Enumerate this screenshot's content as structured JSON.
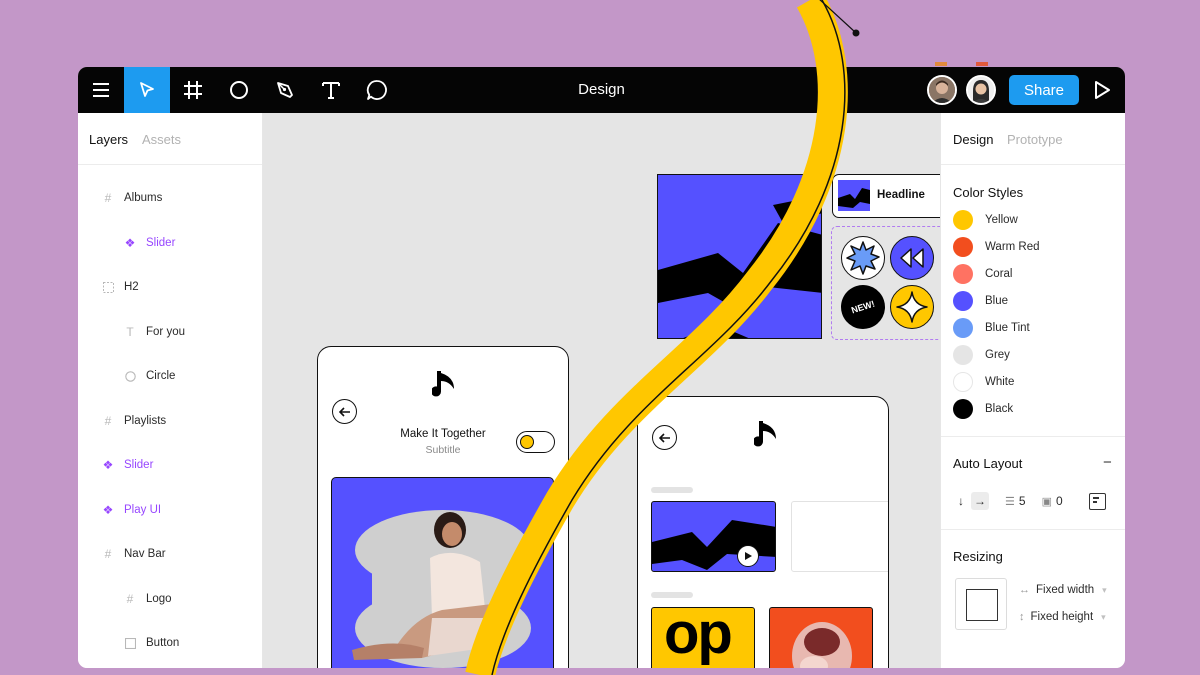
{
  "toolbar": {
    "title": "Design",
    "share_label": "Share",
    "tools": [
      "menu-icon",
      "move-icon",
      "frame-icon",
      "ellipse-icon",
      "pen-icon",
      "text-icon",
      "comment-icon"
    ]
  },
  "left_panel": {
    "tabs": [
      "Layers",
      "Assets"
    ],
    "layers": [
      {
        "label": "Albums",
        "icon": "frame-icon",
        "indent": 0,
        "component": false
      },
      {
        "label": "Slider",
        "icon": "component-icon",
        "indent": 1,
        "component": true
      },
      {
        "label": "H2",
        "icon": "group-icon",
        "indent": 0,
        "component": false
      },
      {
        "label": "For you",
        "icon": "text-icon",
        "indent": 1,
        "component": false
      },
      {
        "label": "Circle",
        "icon": "ellipse-icon",
        "indent": 1,
        "component": false
      },
      {
        "label": "Playlists",
        "icon": "frame-icon",
        "indent": 0,
        "component": false
      },
      {
        "label": "Slider",
        "icon": "component-icon",
        "indent": 0,
        "component": true
      },
      {
        "label": "Play UI",
        "icon": "component-icon",
        "indent": 0,
        "component": true
      },
      {
        "label": "Nav Bar",
        "icon": "frame-icon",
        "indent": 0,
        "component": false
      },
      {
        "label": "Logo",
        "icon": "frame-icon",
        "indent": 1,
        "component": false
      },
      {
        "label": "Button",
        "icon": "rectangle-icon",
        "indent": 1,
        "component": false
      }
    ]
  },
  "right_panel": {
    "tabs": [
      "Design",
      "Prototype"
    ],
    "color_styles_title": "Color Styles",
    "colors": [
      {
        "name": "Yellow",
        "hex": "#ffc700"
      },
      {
        "name": "Warm Red",
        "hex": "#f24e1e"
      },
      {
        "name": "Coral",
        "hex": "#ff7262"
      },
      {
        "name": "Blue",
        "hex": "#5551ff"
      },
      {
        "name": "Blue Tint",
        "hex": "#699bf7"
      },
      {
        "name": "Grey",
        "hex": "#e5e5e5"
      },
      {
        "name": "White",
        "hex": "#ffffff"
      },
      {
        "name": "Black",
        "hex": "#000000"
      }
    ],
    "auto_layout": {
      "title": "Auto Layout",
      "spacing": "5",
      "padding": "0"
    },
    "resizing": {
      "title": "Resizing",
      "width_mode": "Fixed width",
      "height_mode": "Fixed height"
    }
  },
  "canvas": {
    "headline_label": "Headline",
    "new_badge": "NEW!",
    "phone1": {
      "title": "Make It Together",
      "subtitle": "Subtitle"
    },
    "album_text": "op"
  }
}
